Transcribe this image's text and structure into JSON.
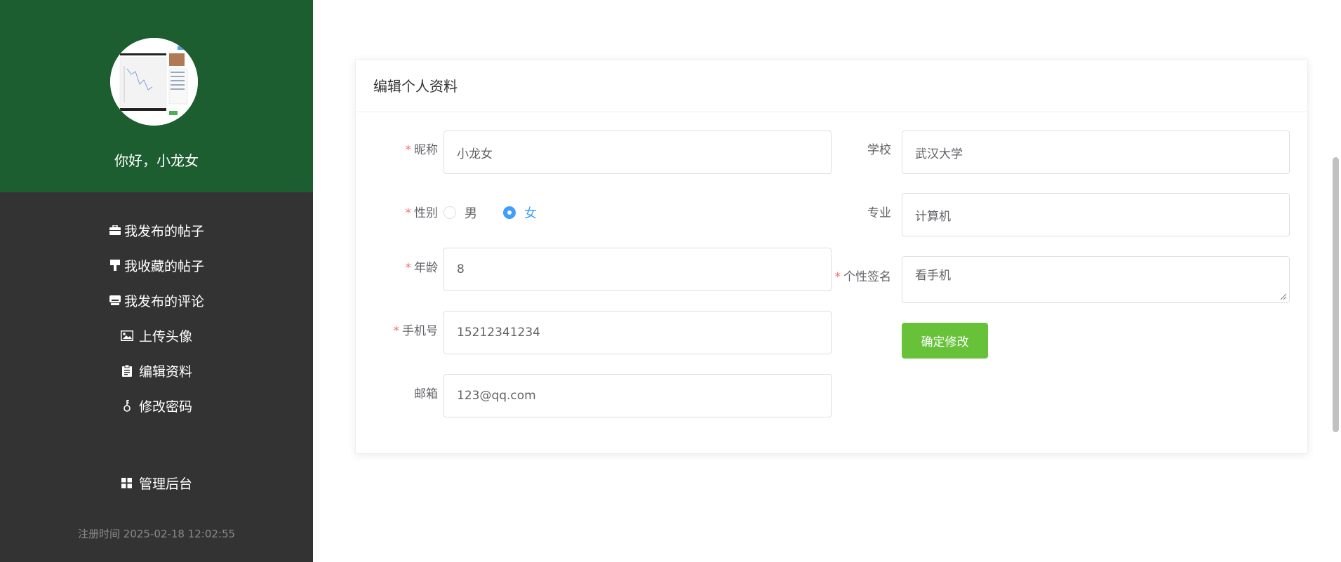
{
  "sidebar": {
    "greeting": "你好，小龙女",
    "nav": [
      {
        "label": "我发布的帖子",
        "icon": "briefcase-icon"
      },
      {
        "label": "我收藏的帖子",
        "icon": "bookmark-icon"
      },
      {
        "label": "我发布的评论",
        "icon": "inbox-icon"
      },
      {
        "label": "上传头像",
        "icon": "image-icon"
      },
      {
        "label": "编辑资料",
        "icon": "clipboard-icon"
      },
      {
        "label": "修改密码",
        "icon": "key-icon"
      },
      {
        "label": "管理后台",
        "icon": "grid-icon"
      }
    ],
    "register_time_label": "注册时间",
    "register_time": "2025-02-18 12:02:55"
  },
  "form": {
    "title": "编辑个人资料",
    "nickname_label": "昵称",
    "nickname": "小龙女",
    "gender_label": "性别",
    "gender_options": [
      "男",
      "女"
    ],
    "gender_selected": "女",
    "age_label": "年龄",
    "age": "8",
    "phone_label": "手机号",
    "phone": "15212341234",
    "email_label": "邮箱",
    "email": "123@qq.com",
    "school_label": "学校",
    "school": "武汉大学",
    "major_label": "专业",
    "major": "计算机",
    "signature_label": "个性签名",
    "signature": "看手机",
    "submit_label": "确定修改"
  },
  "colors": {
    "sidebar_top": "#1d5e31",
    "sidebar": "#333333",
    "primary": "#409eff",
    "success": "#67c23a",
    "required": "#f56c6c"
  }
}
